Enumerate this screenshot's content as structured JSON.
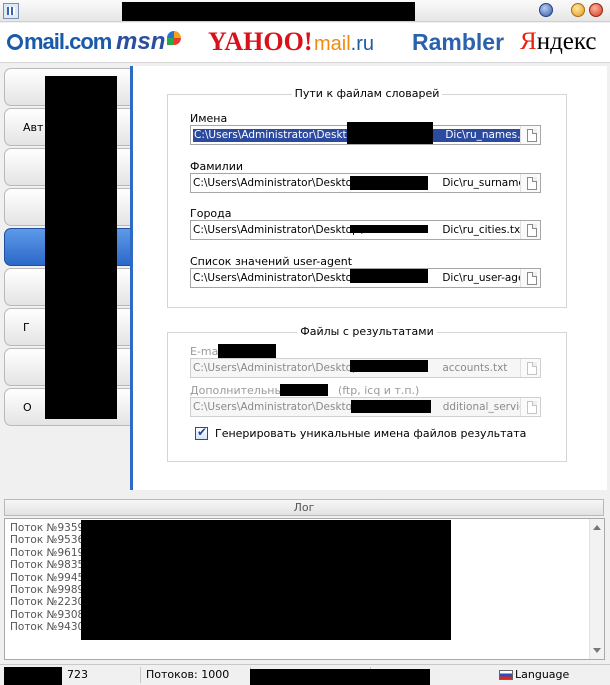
{
  "window": {
    "title": ""
  },
  "logos": {
    "mailcom": "mail.com",
    "msn": "msn",
    "yahoo": "YAHOO!",
    "mailru_main": "mail",
    "mailru_tail": ".ru",
    "rambler": "Rambler",
    "yandex_first": "Я",
    "yandex_rest": "ндекс"
  },
  "sidebar": {
    "tabs": [
      {
        "label": ""
      },
      {
        "label": "Авт"
      },
      {
        "label": ""
      },
      {
        "label": ""
      },
      {
        "label": "",
        "active": true
      },
      {
        "label": ""
      },
      {
        "label": "Г"
      },
      {
        "label": ""
      },
      {
        "label": "О"
      }
    ]
  },
  "dictionaries": {
    "title": "Пути к файлам словарей",
    "fields": [
      {
        "label": "Имена",
        "value": "C:\\Users\\Administrator\\Desktop\\",
        "suffix": "Dic\\ru_names.txt",
        "selected": true
      },
      {
        "label": "Фамилии",
        "value": "C:\\Users\\Administrator\\Desktop\\",
        "suffix": "Dic\\ru_surnames.t:"
      },
      {
        "label": "Города",
        "value": "C:\\Users\\Administrator\\Desktop\\",
        "suffix": "Dic\\ru_cities.txt"
      },
      {
        "label": "Список значений user-agent",
        "value": "C:\\Users\\Administrator\\Desktop\\",
        "suffix": "Dic\\ru_user-agents"
      }
    ]
  },
  "results": {
    "title": "Файлы с результатами",
    "fields": [
      {
        "label": "E-ma",
        "value": "C:\\Users\\Administrator\\Desktop\\",
        "suffix": "accounts.txt"
      },
      {
        "label": "Дополнительные",
        "label_suffix": "(ftp, icq и т.п.)",
        "value": "C:\\Users\\Administrator\\Desktop",
        "suffix": "dditional_services"
      }
    ],
    "generate_unique_checked": true,
    "generate_unique_label": "Генерировать уникальные имена файлов результата"
  },
  "log": {
    "header": "Лог",
    "lines": [
      "Поток №9359:",
      "Поток №9536:",
      "Поток №9619:",
      "Поток №9835:",
      "Поток №9945:",
      "Поток №9989:",
      "Поток №2230:",
      "Поток №9308:",
      "Поток №9430:"
    ]
  },
  "status": {
    "count": "723",
    "threads": "Потоков: 1000",
    "language": "Language"
  },
  "colors": {
    "accent": "#2e6bc6",
    "selection": "#2b4aa0"
  }
}
